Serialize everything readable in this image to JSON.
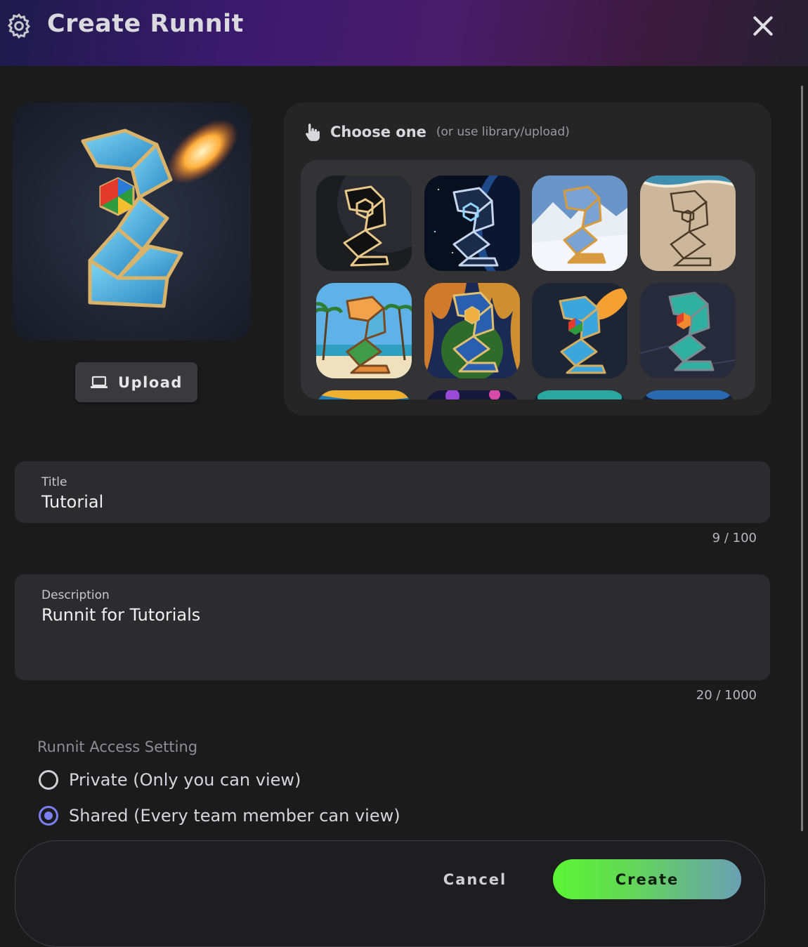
{
  "header": {
    "title": "Create Runnit"
  },
  "upload": {
    "label": "Upload"
  },
  "chooser": {
    "label": "Choose one",
    "hint": "(or use library/upload)",
    "thumbnails": [
      {
        "theme": "dark-gold"
      },
      {
        "theme": "space"
      },
      {
        "theme": "snowy-mountains"
      },
      {
        "theme": "sand"
      },
      {
        "theme": "tropical-beach"
      },
      {
        "theme": "fire-earth"
      },
      {
        "theme": "blue-fire"
      },
      {
        "theme": "dark-teal"
      },
      {
        "theme": "partial"
      },
      {
        "theme": "partial"
      },
      {
        "theme": "partial"
      },
      {
        "theme": "partial"
      }
    ]
  },
  "title_field": {
    "label": "Title",
    "value": "Tutorial",
    "counter": "9 / 100"
  },
  "description_field": {
    "label": "Description",
    "value": "Runnit for Tutorials",
    "counter": "20 / 1000"
  },
  "access": {
    "label": "Runnit Access Setting",
    "options": [
      {
        "label": "Private (Only you can view)",
        "selected": false
      },
      {
        "label": "Shared (Every team member can view)",
        "selected": true
      }
    ]
  },
  "footer": {
    "cancel_label": "Cancel",
    "create_label": "Create"
  },
  "colors": {
    "accent": "#7b7ff0",
    "create_start": "#5cf535",
    "create_end": "#6a9fb5",
    "background": "#1b1b1c"
  }
}
